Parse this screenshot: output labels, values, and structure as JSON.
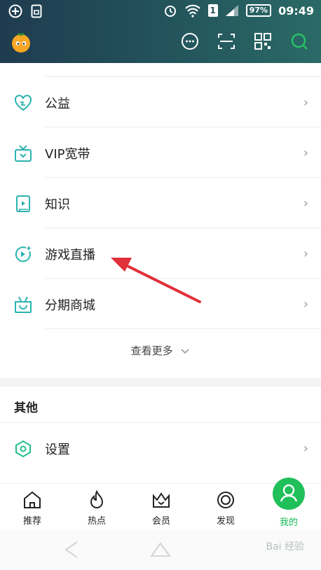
{
  "status_bar": {
    "time": "09:49",
    "battery": "97%",
    "sim": "1"
  },
  "menu_items": [
    {
      "label": "公益",
      "icon": "heart-icon"
    },
    {
      "label": "VIP宽带",
      "icon": "broadband-icon"
    },
    {
      "label": "知识",
      "icon": "book-icon"
    },
    {
      "label": "游戏直播",
      "icon": "game-live-icon"
    },
    {
      "label": "分期商城",
      "icon": "shopping-bag-icon"
    }
  ],
  "more_label": "查看更多",
  "section_other": {
    "title": "其他",
    "items": [
      {
        "label": "设置",
        "icon": "settings-icon"
      }
    ]
  },
  "bottom_tabs": [
    {
      "label": "推荐",
      "icon": "home-icon"
    },
    {
      "label": "热点",
      "icon": "flame-icon"
    },
    {
      "label": "会员",
      "icon": "crown-icon"
    },
    {
      "label": "发现",
      "icon": "discover-icon"
    },
    {
      "label": "我的",
      "icon": "profile-icon",
      "active": true
    }
  ],
  "colors": {
    "accent": "#1fbf5a",
    "icon_teal": "#2bb3b0",
    "header": "#22505a",
    "arrow": "#e0303a"
  },
  "watermark": "Bai 经验"
}
